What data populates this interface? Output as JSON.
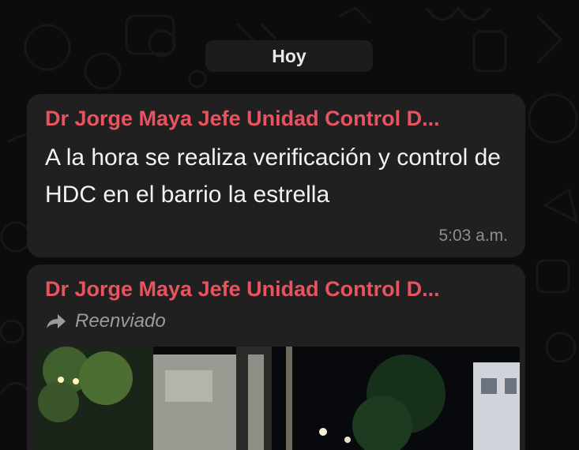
{
  "date_divider": "Hoy",
  "messages": [
    {
      "sender": "Dr Jorge Maya Jefe Unidad Control D...",
      "text": "A la hora se realiza verificación y control de HDC en el barrio la estrella",
      "time": "5:03 a.m."
    },
    {
      "sender": "Dr Jorge Maya Jefe Unidad Control D...",
      "forwarded_label": "Reenviado",
      "forward_icon": "forward-arrow-icon",
      "attachment": "photo"
    }
  ],
  "colors": {
    "sender_name": "#e9525f",
    "bubble": "#202020",
    "background": "#0c0c0c"
  }
}
